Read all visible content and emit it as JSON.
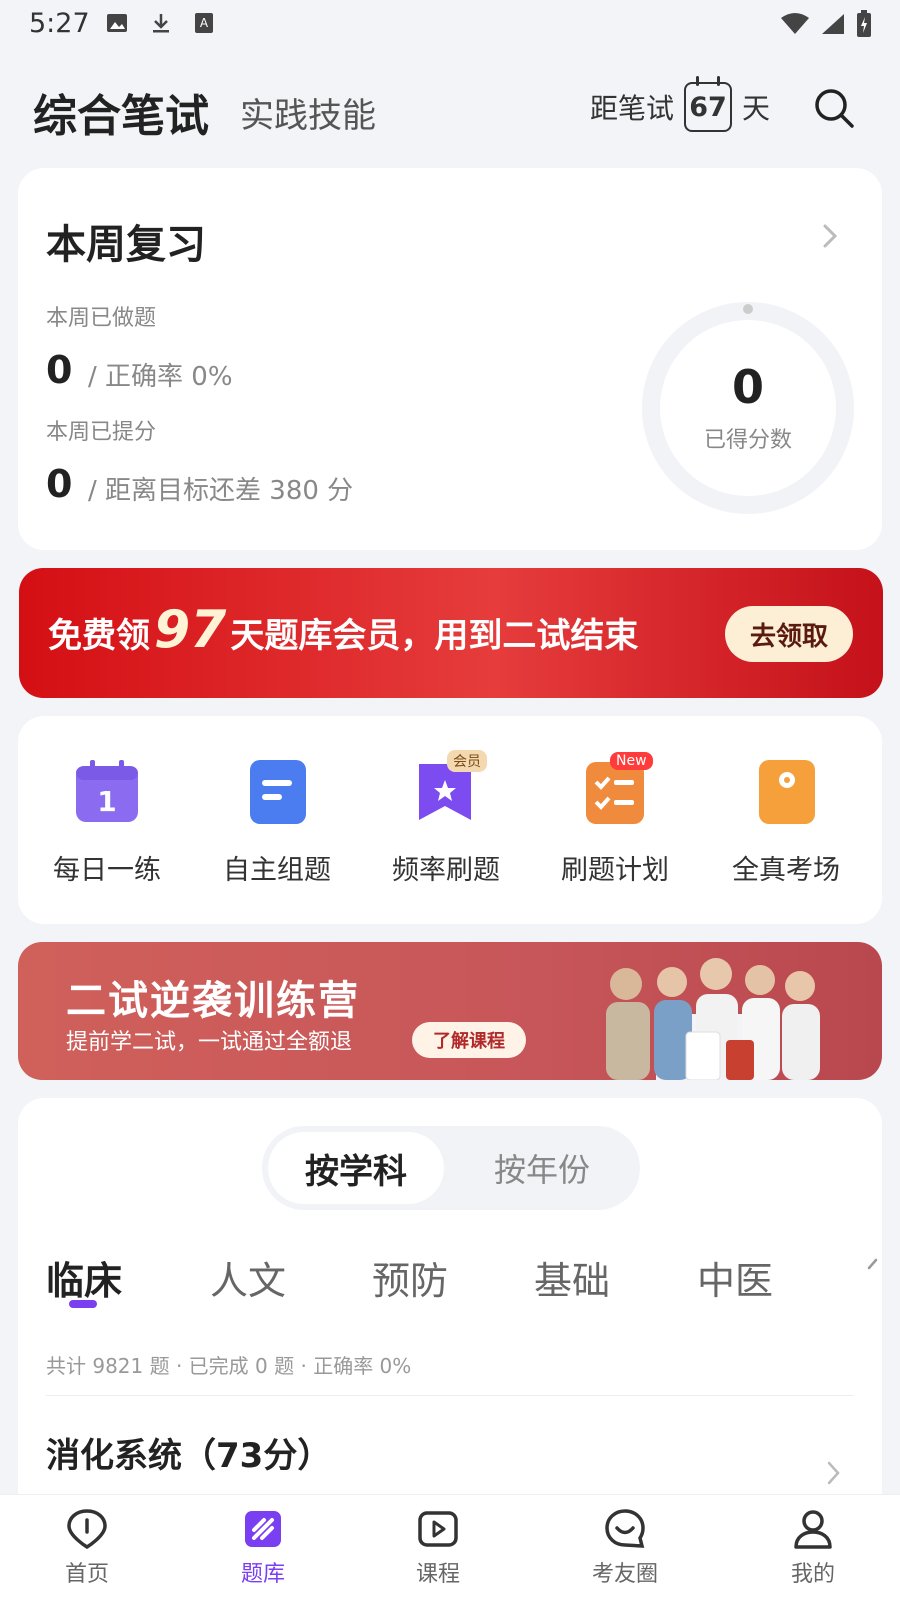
{
  "status_bar": {
    "time": "5:27"
  },
  "header": {
    "title_main": "综合笔试",
    "title_sub": "实践技能",
    "countdown_prefix": "距笔试",
    "countdown_days": "67",
    "countdown_suffix": "天"
  },
  "review": {
    "title": "本周复习",
    "done_label": "本周已做题",
    "done_value": "0",
    "done_note": "/ 正确率 0%",
    "improve_label": "本周已提分",
    "improve_value": "0",
    "improve_note": "/ 距离目标还差 380 分",
    "score_value": "0",
    "score_label": "已得分数"
  },
  "promo": {
    "text_before": "免费领",
    "highlight": "97",
    "text_after": "天题库会员，用到二试结束",
    "button": "去领取"
  },
  "shortcuts": [
    {
      "label": "每日一练",
      "icon": "calendar-icon",
      "icon_text": "1",
      "color": "#8b6cf0"
    },
    {
      "label": "自主组题",
      "icon": "document-icon",
      "color": "#4b7cf0"
    },
    {
      "label": "频率刷题",
      "icon": "bookmark-star-icon",
      "badge": "会员",
      "color": "#7c4cf0"
    },
    {
      "label": "刷题计划",
      "icon": "checklist-icon",
      "badge": "New",
      "color": "#f08a3c"
    },
    {
      "label": "全真考场",
      "icon": "exam-icon",
      "color": "#f5a03a"
    }
  ],
  "camp": {
    "title": "二试逆袭训练营",
    "subtitle": "提前学二试，一试通过全额退",
    "button": "了解课程"
  },
  "segment": {
    "active": "按学科",
    "inactive": "按年份"
  },
  "subject_tabs": [
    "临床",
    "人文",
    "预防",
    "基础",
    "中医"
  ],
  "stats": "共计 9821 题 · 已完成 0 题 · 正确率 0%",
  "section": {
    "title": "消化系统（73分）"
  },
  "bottom_nav": [
    {
      "label": "首页",
      "icon": "home-icon"
    },
    {
      "label": "题库",
      "icon": "question-bank-icon"
    },
    {
      "label": "课程",
      "icon": "play-icon"
    },
    {
      "label": "考友圈",
      "icon": "community-icon"
    },
    {
      "label": "我的",
      "icon": "profile-icon"
    }
  ],
  "colors": {
    "accent": "#7b3ff2",
    "promo_red": "#d40f14",
    "camp_red": "#c7565a"
  }
}
